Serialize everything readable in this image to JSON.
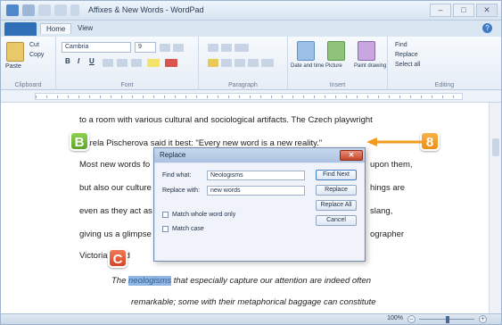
{
  "window": {
    "title": "Affixes & New Words - WordPad",
    "minimize": "–",
    "maximize": "□",
    "close": "✕"
  },
  "ribbon": {
    "file_tab": "",
    "tabs": [
      "Home",
      "View"
    ],
    "clipboard": {
      "label": "Clipboard",
      "paste": "Paste",
      "cut": "Cut",
      "copy": "Copy"
    },
    "font": {
      "label": "Font",
      "family": "Cambria",
      "size": "9",
      "bold": "B",
      "italic": "I",
      "underline": "U"
    },
    "paragraph": {
      "label": "Paragraph"
    },
    "insert": {
      "label": "Insert",
      "date_time": "Date and time",
      "picture": "Picture",
      "paint": "Paint drawing"
    },
    "editing": {
      "label": "Editing",
      "find": "Find",
      "replace": "Replace",
      "select_all": "Select all"
    }
  },
  "document": {
    "lines": [
      "to a room with various cultural and sociological artifacts. The Czech playwright",
      "Karela Pischerova said it best: \"Every new word is a new reality.\"",
      "Most new words fo",
      "but also our culture",
      "even as they act as",
      "giving us a glimpse",
      "Victorians did"
    ],
    "right_fragments": [
      "upon them,",
      "hings are",
      "slang,",
      "ographer"
    ],
    "line_c_highlight": "neologisms",
    "line_c_rest": " that especially capture our attention are indeed often",
    "line_c_prefix": "The ",
    "line_last": "remarkable; some with their metaphorical baggage can constitute"
  },
  "status": {
    "zoom": "100%",
    "zoom_out": "–",
    "zoom_in": "+"
  },
  "replace_dialog": {
    "title": "Replace",
    "find_label": "Find what:",
    "find_value": "Neologisms",
    "replace_label": "Replace with:",
    "replace_value": "new words",
    "match_whole_word": "Match whole word only",
    "match_case": "Match case",
    "buttons": [
      "Find Next",
      "Replace",
      "Replace All",
      "Cancel"
    ]
  },
  "callouts": {
    "b": "B",
    "c": "C",
    "step": "8"
  },
  "colors": {
    "callout_green": "#6ab52f",
    "callout_red": "#e05a36",
    "callout_orange": "#f29b1e",
    "selection": "#8fb7e6"
  }
}
